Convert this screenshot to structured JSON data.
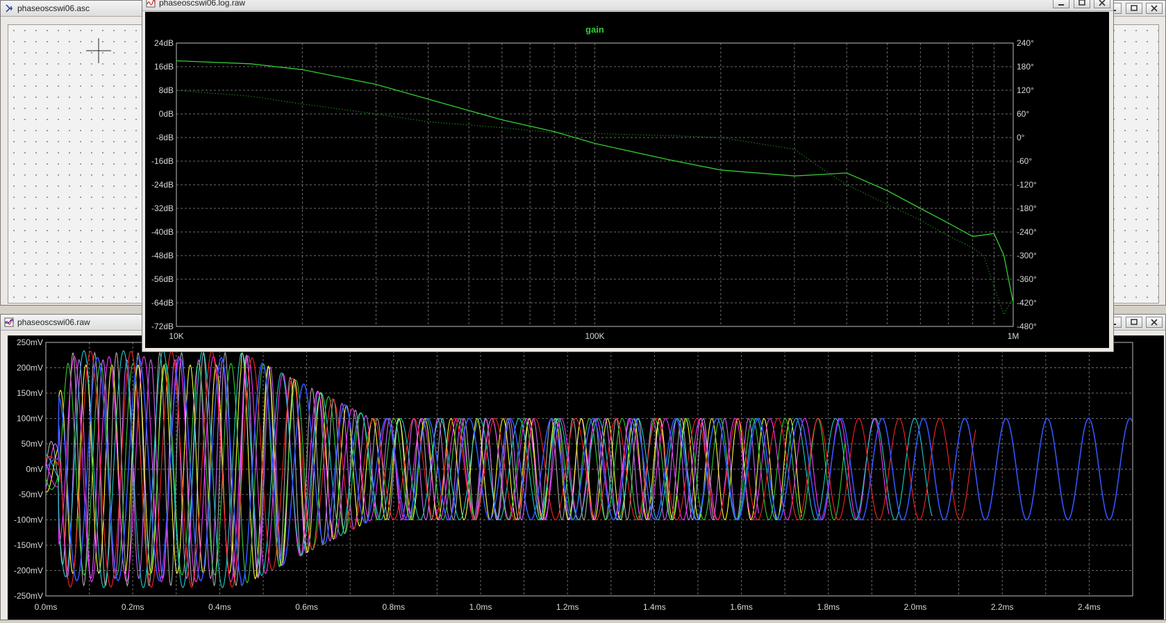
{
  "schematic_window": {
    "title": "phaseoscswi06.asc"
  },
  "transient_window": {
    "title": "phaseoscswi06.raw",
    "y_ticks": [
      "250mV",
      "200mV",
      "150mV",
      "100mV",
      "50mV",
      "0mV",
      "-50mV",
      "-100mV",
      "-150mV",
      "-200mV",
      "-250mV"
    ],
    "x_ticks": [
      "0.0ms",
      "0.2ms",
      "0.4ms",
      "0.6ms",
      "0.8ms",
      "1.0ms",
      "1.2ms",
      "1.4ms",
      "1.6ms",
      "1.8ms",
      "2.0ms",
      "2.2ms",
      "2.4ms"
    ]
  },
  "ac_window": {
    "title": "phaseoscswi06.log.raw",
    "trace_label": "gain",
    "y_left_ticks": [
      "24dB",
      "16dB",
      "8dB",
      "0dB",
      "-8dB",
      "-16dB",
      "-24dB",
      "-32dB",
      "-40dB",
      "-48dB",
      "-56dB",
      "-64dB",
      "-72dB"
    ],
    "y_right_ticks": [
      "240°",
      "180°",
      "120°",
      "60°",
      "0°",
      "-60°",
      "-120°",
      "-180°",
      "-240°",
      "-300°",
      "-360°",
      "-420°",
      "-480°"
    ],
    "x_ticks": [
      "10K",
      "100K",
      "1M"
    ]
  },
  "colors": {
    "plot_bg": "#000000",
    "grid": "#6e6e6e",
    "gain_trace": "#33cc33",
    "transient_traces": [
      "#ff33ff",
      "#3355ff",
      "#ff2222",
      "#22cccc",
      "#33cc33",
      "#ffff33",
      "#cc66ff",
      "#aaaaaa"
    ]
  },
  "chart_data": [
    {
      "type": "line",
      "title": "gain",
      "x_scale": "log",
      "xlim": [
        10000,
        1000000
      ],
      "ylim": [
        -72,
        24
      ],
      "y2lim": [
        -480,
        240
      ],
      "grid": true,
      "series": [
        {
          "name": "gain",
          "axis": "left",
          "style": "solid",
          "x": [
            10000,
            15000,
            20000,
            30000,
            40000,
            60000,
            80000,
            100000,
            150000,
            200000,
            300000,
            350000,
            400000,
            500000,
            600000,
            700000,
            800000,
            850000,
            900000,
            950000,
            1000000
          ],
          "y": [
            18,
            17,
            15,
            10,
            5,
            -2,
            -6,
            -10,
            -15.5,
            -19,
            -21,
            -20.5,
            -20,
            -26,
            -32,
            -37,
            -41.5,
            -41,
            -40.5,
            -48,
            -64
          ]
        },
        {
          "axis": "right",
          "style": "dotted",
          "x": [
            10000,
            15000,
            20000,
            30000,
            40000,
            60000,
            80000,
            100000,
            150000,
            200000,
            300000,
            350000,
            400000,
            500000,
            600000,
            700000,
            800000,
            850000,
            900000,
            950000,
            1000000
          ],
          "y": [
            120,
            105,
            85,
            60,
            40,
            25,
            12,
            10,
            5,
            0,
            -30,
            -80,
            -120,
            -170,
            -210,
            -250,
            -280,
            -300,
            -380,
            -450,
            -405
          ]
        }
      ]
    },
    {
      "type": "line",
      "x_unit": "ms",
      "xlim": [
        0,
        2.5
      ],
      "ylim": [
        -250,
        250
      ],
      "grid": true,
      "description_of_series": "multiple damped sinusoids; amplitude ~230 mV up to 0.45 ms, settling to ~100 mV peak by 0.7 ms",
      "series": [
        {
          "color": "#3355ff",
          "amplitude_mV": 100,
          "period_ms": 0.095
        },
        {
          "color": "#ff2222",
          "amplitude_mV": 100,
          "period_ms": 0.093
        },
        {
          "color": "#22cccc",
          "amplitude_mV": 100,
          "period_ms": 0.091
        },
        {
          "color": "#ff33ff",
          "amplitude_mV": 100,
          "period_ms": 0.08
        },
        {
          "color": "#33cc33",
          "amplitude_mV": 100,
          "period_ms": 0.075
        },
        {
          "color": "#ffff33",
          "amplitude_mV": 100,
          "period_ms": 0.06
        },
        {
          "color": "#cc66ff",
          "amplitude_mV": 100,
          "period_ms": 0.055
        },
        {
          "color": "#aaaaaa",
          "amplitude_mV": 100,
          "period_ms": 0.05
        }
      ]
    }
  ]
}
